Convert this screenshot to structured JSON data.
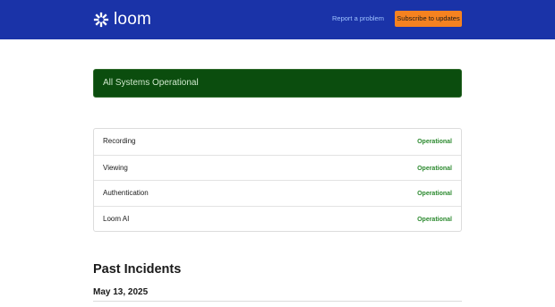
{
  "header": {
    "logo_text": "loom",
    "logo_icon": "loom-burst-icon",
    "report_link": "Report a problem",
    "subscribe_label": "Subscribe to updates"
  },
  "status": {
    "banner_text": "All Systems Operational"
  },
  "components": [
    {
      "name": "Recording",
      "status": "Operational"
    },
    {
      "name": "Viewing",
      "status": "Operational"
    },
    {
      "name": "Authentication",
      "status": "Operational"
    },
    {
      "name": "Loom AI",
      "status": "Operational"
    }
  ],
  "incidents": {
    "heading": "Past Incidents",
    "dates": [
      "May 13, 2025"
    ]
  },
  "colors": {
    "header_bg": "#1a33a8",
    "subscribe_bg": "#f58220",
    "banner_bg": "#0b4d0e",
    "operational": "#2c8a2f"
  }
}
